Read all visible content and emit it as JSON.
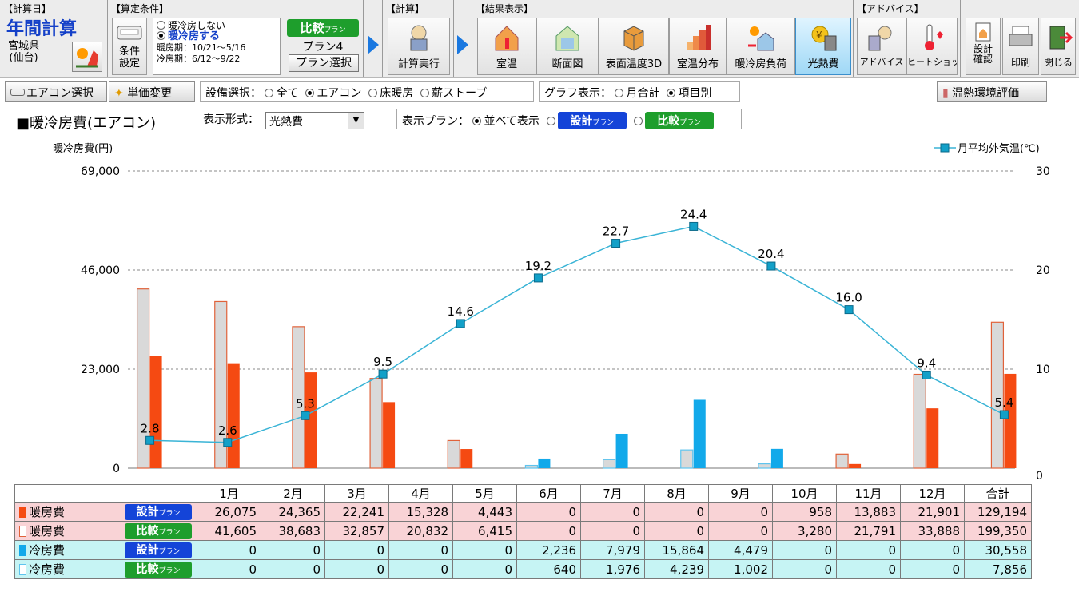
{
  "toolbar": {
    "calc_day": {
      "label": "【計算日】",
      "title": "年間計算",
      "location": "宮城県\n(仙台)"
    },
    "conditions": {
      "label": "【算定条件】",
      "button": "条件\n設定",
      "radio_none": "暖冷房しない",
      "radio_on": "暖冷房する",
      "heating_period": "暖房期：10/21～5/16",
      "cooling_period": "冷房期：6/12～9/22",
      "compare_plan": "比較",
      "plan_suffix": "プラン",
      "plan_name": "プラン4",
      "plan_select": "プラン選択"
    },
    "calc": {
      "label": "【計算】",
      "run": "計算実行"
    },
    "results": {
      "label": "【結果表示】",
      "buttons": [
        "室温",
        "断面図",
        "表面温度3D",
        "室温分布",
        "暖冷房負荷",
        "光熱費"
      ]
    },
    "advice": {
      "label": "【アドバイス】",
      "buttons": [
        "アドバイス",
        "ヒートショック"
      ]
    },
    "misc": {
      "buttons": [
        "設計\n確認",
        "印刷",
        "閉じる"
      ]
    }
  },
  "controls": {
    "aircon_select": "エアコン選択",
    "unit_price": "単価変更",
    "equipment_label": "設備選択：",
    "equipment_options": [
      "全て",
      "エアコン",
      "床暖房",
      "薪ストーブ"
    ],
    "graph_label": "グラフ表示：",
    "graph_options": [
      "月合計",
      "項目別"
    ],
    "env_eval": "温熱環境評価",
    "chart_title": "■暖冷房費(エアコン)",
    "format_label": "表示形式：",
    "format_value": "光熱費",
    "plan_label": "表示プラン：",
    "plan_side": "並べて表示",
    "plan_design": "設計",
    "plan_compare": "比較",
    "plan_suffix": "プラン"
  },
  "chart_data": {
    "type": "bar",
    "ylabel": "暖冷房費(円)",
    "y2label": "月平均外気温(℃)",
    "ylim": [
      0,
      69000
    ],
    "yticks": [
      0,
      23000,
      46000,
      69000
    ],
    "y2lim": [
      0,
      30
    ],
    "y2ticks": [
      0,
      10,
      20,
      30
    ],
    "categories": [
      "1月",
      "2月",
      "3月",
      "4月",
      "5月",
      "6月",
      "7月",
      "8月",
      "9月",
      "10月",
      "11月",
      "12月"
    ],
    "series": [
      {
        "name": "暖房費 設計プラン",
        "values": [
          26075,
          24365,
          22241,
          15328,
          4443,
          0,
          0,
          0,
          0,
          958,
          13883,
          21901
        ],
        "color": "#f54a12"
      },
      {
        "name": "暖房費 比較プラン",
        "values": [
          41605,
          38683,
          32857,
          20832,
          6415,
          0,
          0,
          0,
          0,
          3280,
          21791,
          33888
        ],
        "color": "#d9d9d9",
        "border": "#e0623a"
      },
      {
        "name": "冷房費 設計プラン",
        "values": [
          0,
          0,
          0,
          0,
          0,
          2236,
          7979,
          15864,
          4479,
          0,
          0,
          0
        ],
        "color": "#12a9ea"
      },
      {
        "name": "冷房費 比較プラン",
        "values": [
          0,
          0,
          0,
          0,
          0,
          640,
          1976,
          4239,
          1002,
          0,
          0,
          0
        ],
        "color": "#d9d9d9",
        "border": "#5fc4ee"
      }
    ],
    "temperature": {
      "name": "月平均外気温(℃)",
      "values": [
        2.8,
        2.6,
        5.3,
        9.5,
        14.6,
        19.2,
        22.7,
        24.4,
        20.4,
        16.0,
        9.4,
        5.4
      ],
      "labels": [
        "2.8",
        "2.6",
        "5.3",
        "9.5",
        "14.6",
        "19.2",
        "22.7",
        "24.4",
        "20.4",
        "16.0",
        "9.4",
        "5.4"
      ],
      "color": "#3ab4d6"
    },
    "ytick_labels": [
      "0",
      "23,000",
      "46,000",
      "69,000"
    ],
    "y2tick_labels": [
      "0",
      "10",
      "20",
      "30"
    ]
  },
  "table": {
    "headers": [
      "1月",
      "2月",
      "3月",
      "4月",
      "5月",
      "6月",
      "7月",
      "8月",
      "9月",
      "10月",
      "11月",
      "12月",
      "合計"
    ],
    "rows": [
      {
        "label": "暖房費",
        "plan": "設計",
        "plan_type": "design",
        "swatch": "#f54a12",
        "style": "rowpink",
        "values": [
          "26,075",
          "24,365",
          "22,241",
          "15,328",
          "4,443",
          "0",
          "0",
          "0",
          "0",
          "958",
          "13,883",
          "21,901",
          "129,194"
        ]
      },
      {
        "label": "暖房費",
        "plan": "比較",
        "plan_type": "compare",
        "swatch": "#ffffff",
        "style": "rowpink",
        "values": [
          "41,605",
          "38,683",
          "32,857",
          "20,832",
          "6,415",
          "0",
          "0",
          "0",
          "0",
          "3,280",
          "21,791",
          "33,888",
          "199,350"
        ]
      },
      {
        "label": "冷房費",
        "plan": "設計",
        "plan_type": "design",
        "swatch": "#12a9ea",
        "style": "rowcyan",
        "values": [
          "0",
          "0",
          "0",
          "0",
          "0",
          "2,236",
          "7,979",
          "15,864",
          "4,479",
          "0",
          "0",
          "0",
          "30,558"
        ]
      },
      {
        "label": "冷房費",
        "plan": "比較",
        "plan_type": "compare",
        "swatch": "#ffffff",
        "style": "rowcyan",
        "values": [
          "0",
          "0",
          "0",
          "0",
          "0",
          "640",
          "1,976",
          "4,239",
          "1,002",
          "0",
          "0",
          "0",
          "7,856"
        ]
      }
    ],
    "plan_suffix": "プラン"
  }
}
